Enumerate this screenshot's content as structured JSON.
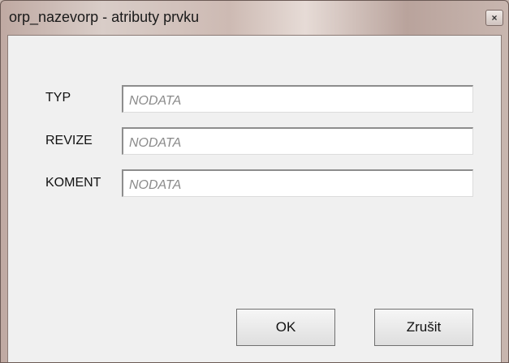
{
  "window": {
    "title": "orp_nazevorp - atributy prvku",
    "close_glyph": "×"
  },
  "fields": [
    {
      "label": "TYP",
      "value": "NODATA"
    },
    {
      "label": "REVIZE",
      "value": "NODATA"
    },
    {
      "label": "KOMENT",
      "value": "NODATA"
    }
  ],
  "buttons": {
    "ok_label": "OK",
    "cancel_label": "Zrušit"
  }
}
